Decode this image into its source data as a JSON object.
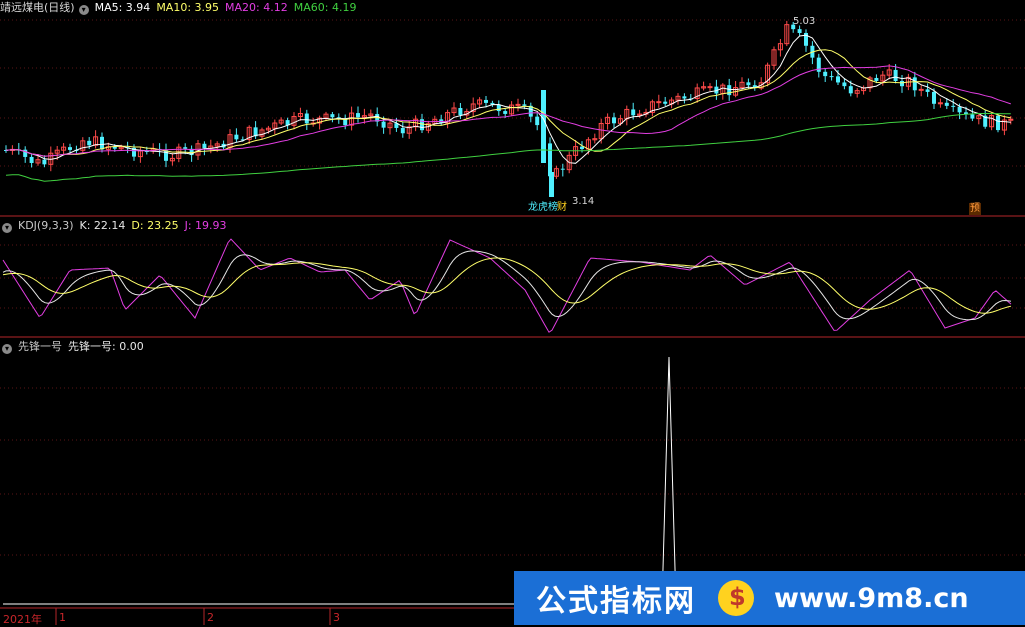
{
  "main_panel": {
    "stock_name": "靖远煤电(日线)",
    "ma5": "MA5: 3.94",
    "ma10": "MA10: 3.95",
    "ma20": "MA20: 4.12",
    "ma60": "MA60: 4.19",
    "high_label": "5.03",
    "low_label": "3.14",
    "tag_rank": "龙虎榜",
    "tag_finance": "财",
    "tag_forecast": "预"
  },
  "kdj_panel": {
    "title": "KDJ(9,3,3)",
    "k": "K: 22.14",
    "d": "D: 23.25",
    "j": "J: 19.93"
  },
  "indicator_panel": {
    "title": "先锋一号",
    "value": "先锋一号: 0.00"
  },
  "x_axis": {
    "year": "2021年",
    "months": [
      "1",
      "2",
      "3"
    ]
  },
  "watermark": {
    "brand": "公式指标网",
    "url": "www.9m8.cn"
  },
  "colors": {
    "up": "#ff4a4a",
    "down": "#4ff0ff",
    "ma5": "#ffffff",
    "ma10": "#ffff6a",
    "ma20": "#e23ee2",
    "ma60": "#40d040",
    "separator": "#b3262a",
    "watermark_bg": "#1b6fd6"
  }
}
